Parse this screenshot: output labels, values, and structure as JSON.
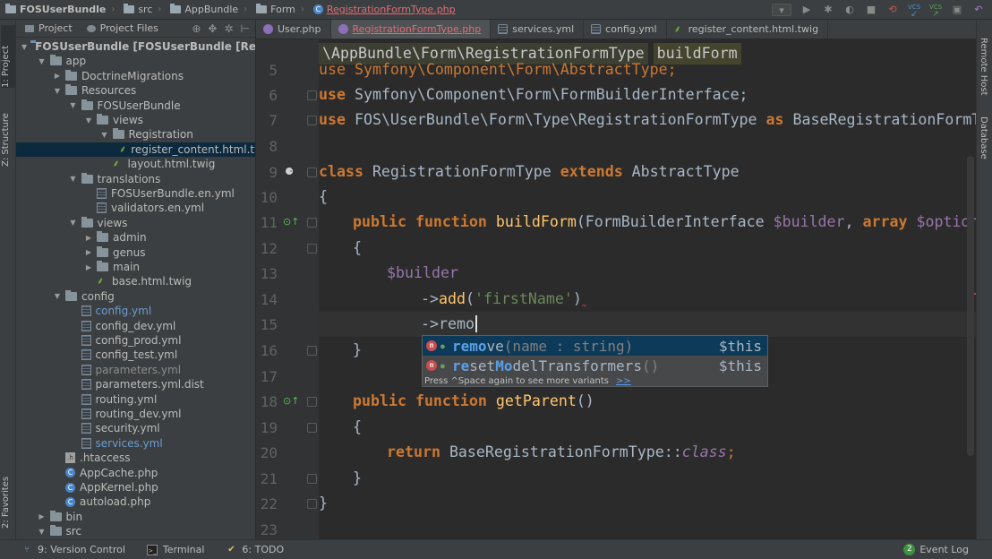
{
  "breadcrumbs": [
    {
      "label": "FOSUserBundle",
      "icon": "folder-icon",
      "bold": true
    },
    {
      "label": "src",
      "icon": "folder-icon"
    },
    {
      "label": "AppBundle",
      "icon": "folder-icon"
    },
    {
      "label": "Form",
      "icon": "folder-icon"
    },
    {
      "label": "RegistrationFormType.php",
      "icon": "php-class-icon",
      "active": true
    }
  ],
  "toolbar": {
    "vcs1": "VCS",
    "vcs2": "VCS"
  },
  "left_stripe": {
    "project": "1: Project",
    "structure": "Z: Structure",
    "favorites": "2: Favorites"
  },
  "right_stripe": {
    "remote_host": "Remote Host",
    "database": "Database"
  },
  "project_panel": {
    "tab_project": "Project",
    "tab_project_files": "Project Files",
    "tree": [
      {
        "depth": 0,
        "open": true,
        "type": "folder",
        "label": "FOSUserBundle [FOSUserBundle [Recordi",
        "bold": true
      },
      {
        "depth": 1,
        "open": true,
        "type": "folder",
        "label": "app"
      },
      {
        "depth": 2,
        "open": false,
        "type": "folder",
        "label": "DoctrineMigrations"
      },
      {
        "depth": 2,
        "open": true,
        "type": "folder",
        "label": "Resources"
      },
      {
        "depth": 3,
        "open": true,
        "type": "folder",
        "label": "FOSUserBundle"
      },
      {
        "depth": 4,
        "open": true,
        "type": "folder",
        "label": "views"
      },
      {
        "depth": 5,
        "open": true,
        "type": "folder",
        "label": "Registration"
      },
      {
        "depth": 6,
        "type": "twig",
        "label": "register_content.html.tw",
        "selected": true
      },
      {
        "depth": 5,
        "type": "twig",
        "label": "layout.html.twig"
      },
      {
        "depth": 3,
        "open": true,
        "type": "folder",
        "label": "translations"
      },
      {
        "depth": 4,
        "type": "yml",
        "label": "FOSUserBundle.en.yml"
      },
      {
        "depth": 4,
        "type": "yml",
        "label": "validators.en.yml"
      },
      {
        "depth": 3,
        "open": true,
        "type": "folder",
        "label": "views"
      },
      {
        "depth": 4,
        "open": false,
        "type": "folder",
        "label": "admin"
      },
      {
        "depth": 4,
        "open": false,
        "type": "folder",
        "label": "genus"
      },
      {
        "depth": 4,
        "open": false,
        "type": "folder",
        "label": "main"
      },
      {
        "depth": 4,
        "type": "twig",
        "label": "base.html.twig"
      },
      {
        "depth": 2,
        "open": true,
        "type": "folder",
        "label": "config"
      },
      {
        "depth": 3,
        "type": "yml",
        "label": "config.yml",
        "color": "blue"
      },
      {
        "depth": 3,
        "type": "yml",
        "label": "config_dev.yml"
      },
      {
        "depth": 3,
        "type": "yml",
        "label": "config_prod.yml"
      },
      {
        "depth": 3,
        "type": "yml",
        "label": "config_test.yml"
      },
      {
        "depth": 3,
        "type": "yml",
        "label": "parameters.yml",
        "color": "gray"
      },
      {
        "depth": 3,
        "type": "yml",
        "label": "parameters.yml.dist"
      },
      {
        "depth": 3,
        "type": "yml",
        "label": "routing.yml"
      },
      {
        "depth": 3,
        "type": "yml",
        "label": "routing_dev.yml"
      },
      {
        "depth": 3,
        "type": "yml",
        "label": "security.yml"
      },
      {
        "depth": 3,
        "type": "yml",
        "label": "services.yml",
        "color": "blue"
      },
      {
        "depth": 2,
        "type": "htaccess",
        "label": ".htaccess"
      },
      {
        "depth": 2,
        "type": "php",
        "label": "AppCache.php"
      },
      {
        "depth": 2,
        "type": "php",
        "label": "AppKernel.php"
      },
      {
        "depth": 2,
        "type": "php",
        "label": "autoload.php"
      },
      {
        "depth": 1,
        "open": false,
        "type": "folder",
        "label": "bin"
      },
      {
        "depth": 1,
        "open": true,
        "type": "folder",
        "label": "src"
      }
    ]
  },
  "tabs": [
    {
      "label": "User.php",
      "icon": "php"
    },
    {
      "label": "RegistrationFormType.php",
      "icon": "php",
      "active": true
    },
    {
      "label": "services.yml",
      "icon": "yml"
    },
    {
      "label": "config.yml",
      "icon": "yml"
    },
    {
      "label": "register_content.html.twig",
      "icon": "twig"
    }
  ],
  "editor": {
    "breadcrumb_class": "\\AppBundle\\Form\\RegistrationFormType",
    "breadcrumb_method": "buildForm",
    "line_numbers": [
      "5",
      "6",
      "7",
      "8",
      "9",
      "10",
      "11",
      "12",
      "13",
      "14",
      "15",
      "16",
      "17",
      "18",
      "19",
      "20",
      "21",
      "22",
      "23"
    ],
    "lines": {
      "l5": "use Symfony\\Component\\Form\\AbstractType;",
      "l6_kw": "use",
      "l6_rest": " Symfony\\Component\\Form\\FormBuilderInterface;",
      "l7_kw": "use",
      "l7_mid": " FOS\\UserBundle\\Form\\Type\\RegistrationFormType ",
      "l7_as": "as",
      "l7_end": " BaseRegistrationFormType",
      "l9_class": "class",
      "l9_name": " RegistrationFormType ",
      "l9_extends": "extends",
      "l9_parent": " AbstractType",
      "l10": "{",
      "l11_public": "public",
      "l11_function": "function",
      "l11_name": "buildForm",
      "l11_open": "(FormBuilderInterface ",
      "l11_var1": "$builder",
      "l11_comma": ", ",
      "l11_array": "array",
      "l11_space": " ",
      "l11_var2": "$options",
      "l11_close": ")",
      "l12": "{",
      "l13_var": "$builder",
      "l14_arrow": "->",
      "l14_fn": "add",
      "l14_open": "(",
      "l14_str": "'firstName'",
      "l14_close": ")",
      "l15_arrow": "->",
      "l15_typed": "remo",
      "l16": "}",
      "l18_public": "public",
      "l18_function": "function",
      "l18_name": "getParent",
      "l18_parens": "()",
      "l19": "{",
      "l20_return": "return",
      "l20_cls": " BaseRegistrationFormType::",
      "l20_class": "class",
      "l20_semi": ";",
      "l21": "}",
      "l22": "}"
    }
  },
  "completion": {
    "items": [
      {
        "match": "remo",
        "rest": "ve",
        "args": "(name : string)",
        "ret": "$this",
        "selected": true
      },
      {
        "match_pre": "r",
        "match_mid": "e",
        "rest_a": "set",
        "match2": "Mo",
        "rest_b": "delTransformers",
        "args": "()",
        "ret": "$this"
      }
    ],
    "footer": "Press ^Space again to see more variants",
    "footer_link": ">>"
  },
  "status_bar": {
    "version_control": "9: Version Control",
    "terminal": "Terminal",
    "todo": "6: TODO",
    "event_log": "Event Log",
    "event_count": "2"
  }
}
